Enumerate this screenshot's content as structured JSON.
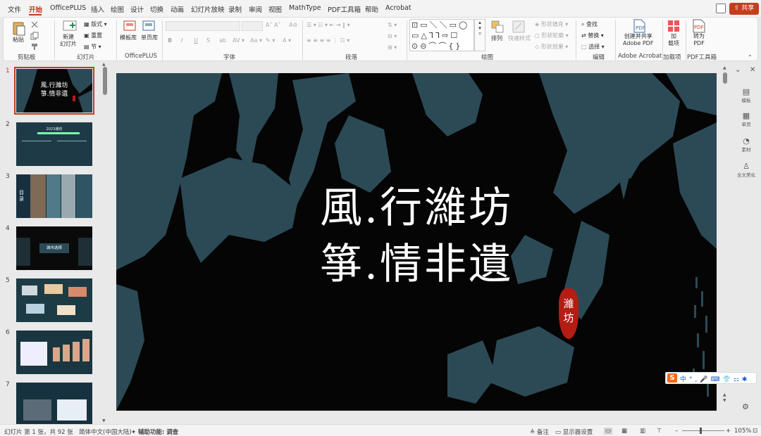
{
  "menu": {
    "tabs": [
      "文件",
      "开始",
      "OfficePLUS",
      "插入",
      "绘图",
      "设计",
      "切换",
      "动画",
      "幻灯片放映",
      "录制",
      "审阅",
      "视图",
      "MathType",
      "PDF工具箱",
      "帮助",
      "Acrobat"
    ],
    "active_tab": "开始",
    "share_label": "共享"
  },
  "ribbon": {
    "clipboard": {
      "paste": "粘贴",
      "label": "剪贴板"
    },
    "slides": {
      "new_slide": "新建\n幻灯片",
      "layout": "版式",
      "reset": "重置",
      "section": "节",
      "label": "幻灯片"
    },
    "officeplus": {
      "template": "模板库",
      "single": "单页库",
      "label": "OfficePLUS"
    },
    "font": {
      "bold": "B",
      "italic": "I",
      "underline": "U",
      "strike": "S",
      "label": "字体"
    },
    "paragraph": {
      "label": "段落"
    },
    "drawing": {
      "arrange": "排列",
      "quick_styles": "快速样式",
      "fill": "形状填充",
      "outline": "形状轮廓",
      "effects": "形状效果",
      "label": "绘图"
    },
    "editing": {
      "find": "查找",
      "replace": "替换",
      "select": "选择",
      "label": "编辑"
    },
    "acrobat": {
      "create_share": "创建并共享\nAdobe PDF",
      "label": "Adobe Acrobat"
    },
    "addins": {
      "addin": "加\n载项",
      "label": "加载项"
    },
    "pdftools": {
      "to_pdf": "转为\nPDF",
      "label": "PDF工具箱"
    }
  },
  "slides_pane": {
    "numbers": [
      "1",
      "2",
      "3",
      "4",
      "5",
      "6",
      "7"
    ],
    "selected": "1",
    "thumb1_title": [
      "風.行濰坊",
      "箏.情非遺"
    ],
    "thumb2_title": "2023潍坊",
    "thumb3_label": "目录",
    "thumb4_label": "城市选择"
  },
  "slide": {
    "title_line1": "風.行濰坊",
    "title_line2": "箏.情非遺",
    "seal_text": "濰\n坊",
    "colors": {
      "background": "#050505",
      "brush": "#2b4a55",
      "seal": "#b31d14",
      "title": "#ffffff"
    }
  },
  "side_panel": {
    "items": [
      "模板",
      "单页",
      "素材",
      "全文美化"
    ]
  },
  "ime": {
    "items": [
      "中",
      "°,",
      "🎤",
      "⌨",
      "👕",
      "⚏",
      "✱"
    ]
  },
  "status": {
    "slide_info": "幻灯片 第 1 张，共 92 张",
    "language": "简体中文(中国大陆)",
    "accessibility": "辅助功能: 调查",
    "notes": "备注",
    "display_settings": "显示器设置",
    "zoom": "105%"
  },
  "accent_color": "#c43e1c"
}
